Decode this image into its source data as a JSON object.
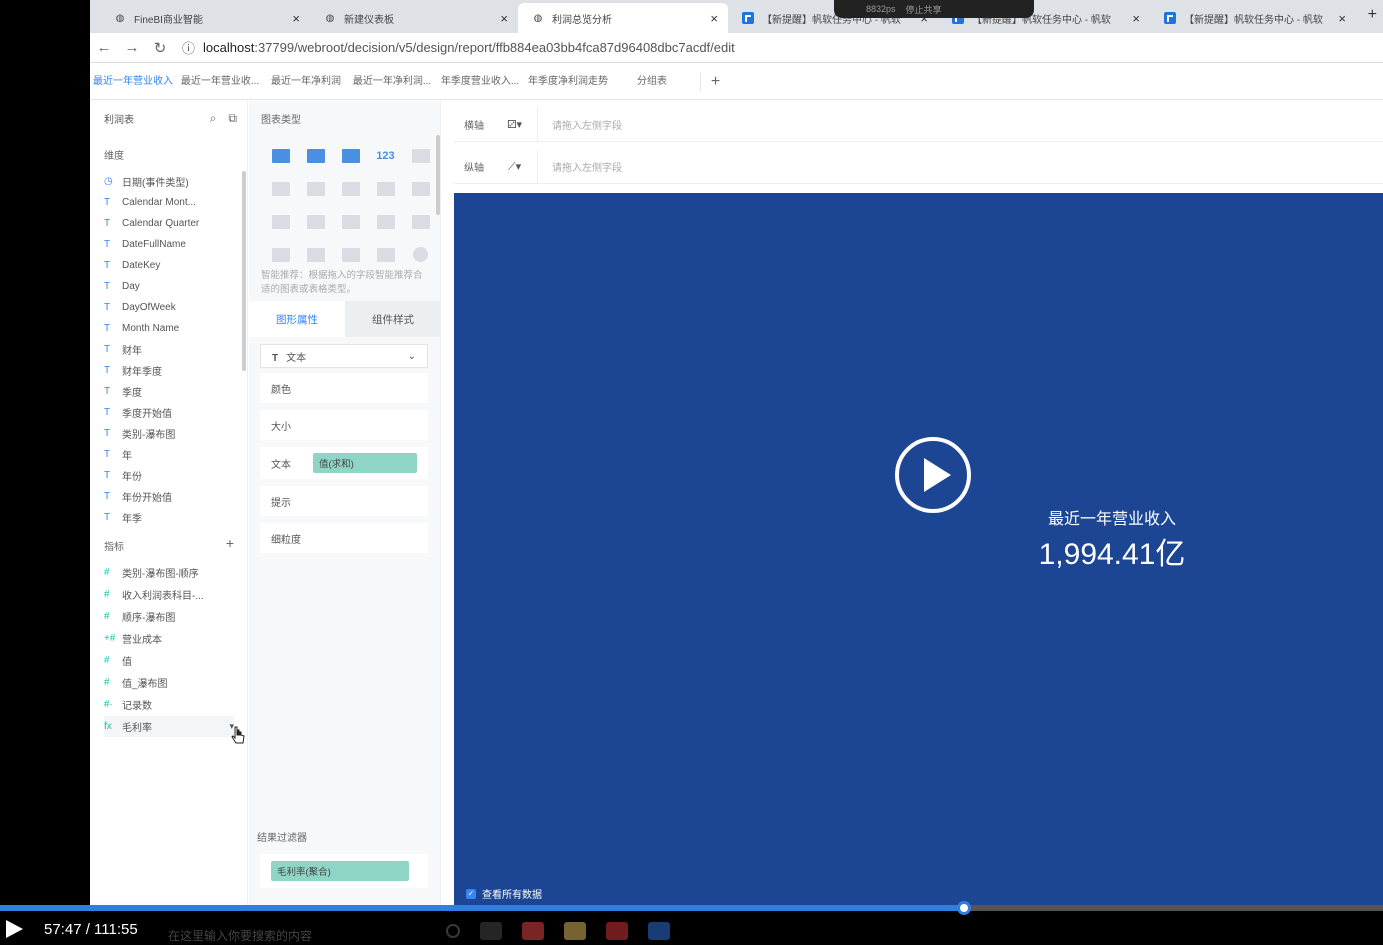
{
  "browser": {
    "tabs": [
      {
        "title": "FineBI商业智能"
      },
      {
        "title": "新建仪表板"
      },
      {
        "title": "利润总览分析"
      },
      {
        "title": "【新提醒】帆软任务中心 - 帆软"
      },
      {
        "title": "【新提醒】帆软任务中心 - 帆软"
      },
      {
        "title": "【新提醒】帆软任务中心 - 帆软"
      }
    ],
    "notification": {
      "speed": "8832ps",
      "stop_share": "停止共享"
    },
    "url_host": "localhost",
    "url_rest": ":37799/webroot/decision/v5/design/report/ffb884ea03bb4fca87d96408dbc7acdf/edit"
  },
  "report_tabs": [
    "最近一年营业收入",
    "最近一年营业收...",
    "最近一年净利润",
    "最近一年净利润...",
    "年季度营业收入...",
    "年季度净利润走势",
    "分组表"
  ],
  "left": {
    "table_name": "利润表",
    "dimension_label": "维度",
    "dimensions": [
      {
        "icon": "clock-icon",
        "glyph": "◷",
        "label": "日期(事件类型)"
      },
      {
        "icon": "text-type-icon",
        "glyph": "T",
        "label": "Calendar Mont..."
      },
      {
        "icon": "text-type-icon",
        "glyph": "T",
        "label": "Calendar Quarter"
      },
      {
        "icon": "text-type-icon",
        "glyph": "T",
        "label": "DateFullName"
      },
      {
        "icon": "text-type-icon",
        "glyph": "T",
        "label": "DateKey"
      },
      {
        "icon": "text-type-icon",
        "glyph": "T",
        "label": "Day"
      },
      {
        "icon": "text-type-icon",
        "glyph": "T",
        "label": "DayOfWeek"
      },
      {
        "icon": "text-type-icon",
        "glyph": "T",
        "label": "Month Name"
      },
      {
        "icon": "text-type-icon",
        "glyph": "T",
        "label": "财年"
      },
      {
        "icon": "text-type-icon",
        "glyph": "T",
        "label": "财年季度"
      },
      {
        "icon": "text-type-icon",
        "glyph": "T",
        "label": "季度"
      },
      {
        "icon": "text-type-icon",
        "glyph": "T",
        "label": "季度开始值"
      },
      {
        "icon": "text-type-icon",
        "glyph": "T",
        "label": "类别-瀑布图"
      },
      {
        "icon": "text-type-icon",
        "glyph": "T",
        "label": "年"
      },
      {
        "icon": "text-type-icon",
        "glyph": "T",
        "label": "年份"
      },
      {
        "icon": "text-type-icon",
        "glyph": "T",
        "label": "年份开始值"
      },
      {
        "icon": "text-type-icon",
        "glyph": "T",
        "label": "年季"
      }
    ],
    "measure_label": "指标",
    "measures": [
      {
        "icon": "number-icon",
        "glyph": "#",
        "label": "类别-瀑布图-顺序"
      },
      {
        "icon": "number-icon",
        "glyph": "#",
        "label": "收入利润表科目-..."
      },
      {
        "icon": "number-icon",
        "glyph": "#",
        "label": "顺序-瀑布图"
      },
      {
        "icon": "number-icon",
        "glyph": "+#",
        "label": "营业成本"
      },
      {
        "icon": "number-icon",
        "glyph": "#",
        "label": "值"
      },
      {
        "icon": "number-icon",
        "glyph": "#",
        "label": "值_瀑布图"
      },
      {
        "icon": "number-icon",
        "glyph": "#·",
        "label": "记录数"
      },
      {
        "icon": "formula-icon",
        "glyph": "fx",
        "label": "毛利率"
      }
    ]
  },
  "middle": {
    "chart_type_label": "图表类型",
    "smart_hint": "智能推荐：根据拖入的字段智能推荐合适的图表或表格类型。",
    "tab_graphic": "图形属性",
    "tab_style": "组件样式",
    "mark_type": "文本",
    "color_label": "颜色",
    "size_label": "大小",
    "text_label": "文本",
    "text_value_pill": "值(求和)",
    "tooltip_label": "提示",
    "granularity_label": "细粒度",
    "filter_label": "结果过滤器",
    "filter_pill": "毛利率(聚合)"
  },
  "right": {
    "x_axis_label": "横轴",
    "y_axis_label": "纵轴",
    "drop_placeholder": "请拖入左侧字段",
    "kpi_title": "最近一年营业收入",
    "kpi_value": "1,994.41亿",
    "view_all_data": "查看所有数据"
  },
  "player": {
    "time": "57:47 / 111:55",
    "progress": 0.697,
    "search_placeholder": "在这里输入你要搜索的内容"
  }
}
